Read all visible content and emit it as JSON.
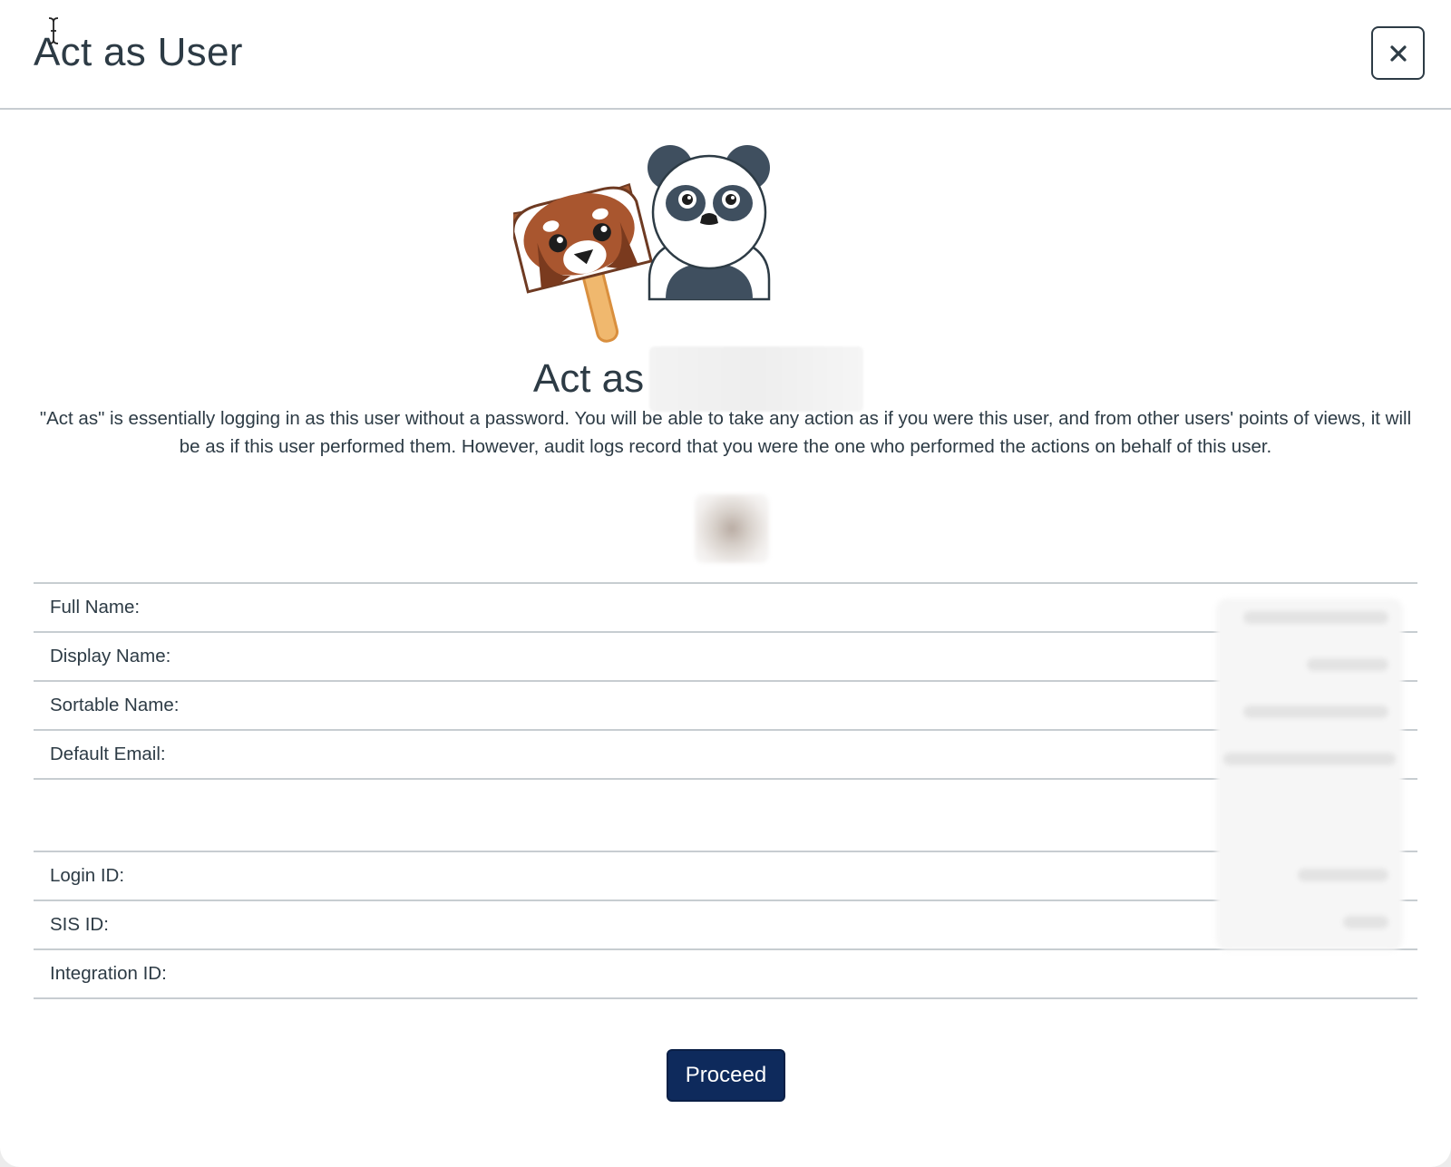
{
  "modal": {
    "title": "Act as User",
    "close_icon": "close-icon"
  },
  "hero": {
    "heading_prefix": "Act as",
    "mascots": [
      "red-panda-icon",
      "panda-icon"
    ]
  },
  "description": "\"Act as\" is essentially logging in as this user without a password. You will be able to take any action as if you were this user, and from other users' points of views, it will be as if this user performed them. However, audit logs record that you were the one who performed the actions on behalf of this user.",
  "user_info": {
    "rows": [
      {
        "label": "Full Name:"
      },
      {
        "label": "Display Name:"
      },
      {
        "label": "Sortable Name:"
      },
      {
        "label": "Default Email:"
      },
      {
        "label": ""
      },
      {
        "label": "Login ID:"
      },
      {
        "label": "SIS ID:"
      },
      {
        "label": "Integration ID:"
      }
    ]
  },
  "actions": {
    "proceed_label": "Proceed"
  },
  "colors": {
    "text": "#2d3b45",
    "primary_button": "#0e2a5c",
    "divider": "#c7cdd1"
  }
}
